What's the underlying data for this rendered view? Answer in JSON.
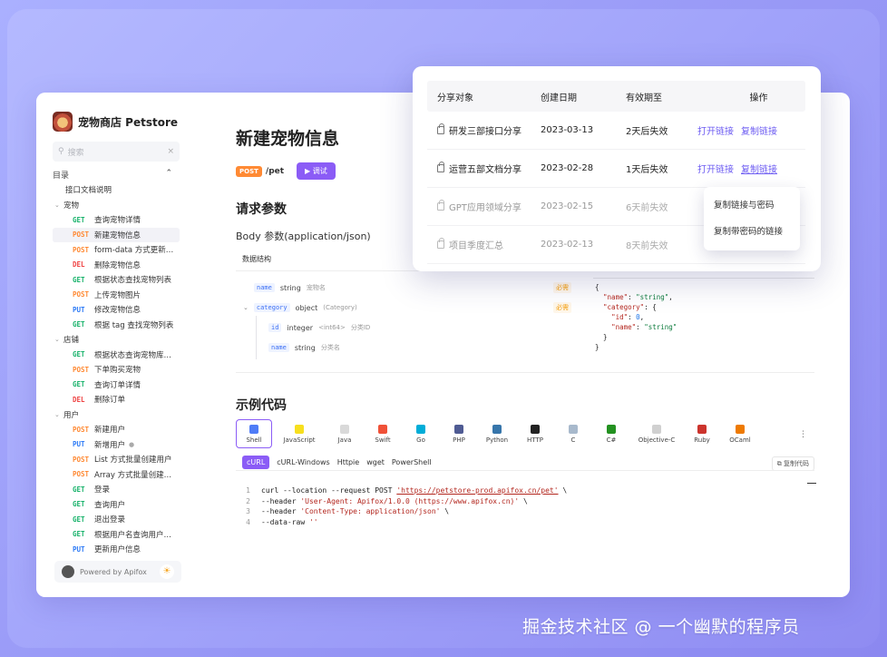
{
  "sidebar": {
    "brand": "宠物商店 Petstore",
    "search_placeholder": "搜索",
    "toc_label": "目录",
    "nav": [
      {
        "kind": "doc",
        "label": "接口文档说明"
      },
      {
        "kind": "group",
        "label": "宠物"
      },
      {
        "kind": "item",
        "method": "GET",
        "label": "查询宠物详情"
      },
      {
        "kind": "item",
        "method": "POST",
        "label": "新建宠物信息",
        "active": true
      },
      {
        "kind": "item",
        "method": "POST",
        "label": "form-data 方式更新宠..."
      },
      {
        "kind": "item",
        "method": "DEL",
        "label": "删除宠物信息"
      },
      {
        "kind": "item",
        "method": "GET",
        "label": "根据状态查找宠物列表"
      },
      {
        "kind": "item",
        "method": "POST",
        "label": "上传宠物图片"
      },
      {
        "kind": "item",
        "method": "PUT",
        "label": "修改宠物信息"
      },
      {
        "kind": "item",
        "method": "GET",
        "label": "根据 tag 查找宠物列表"
      },
      {
        "kind": "group",
        "label": "店铺"
      },
      {
        "kind": "item",
        "method": "GET",
        "label": "根据状态查询宠物库存数"
      },
      {
        "kind": "item",
        "method": "POST",
        "label": "下单购买宠物"
      },
      {
        "kind": "item",
        "method": "GET",
        "label": "查询订单详情"
      },
      {
        "kind": "item",
        "method": "DEL",
        "label": "删除订单"
      },
      {
        "kind": "group",
        "label": "用户"
      },
      {
        "kind": "item",
        "method": "POST",
        "label": "新建用户"
      },
      {
        "kind": "item",
        "method": "PUT",
        "label": "新增用户",
        "dot": true
      },
      {
        "kind": "item",
        "method": "POST",
        "label": "List 方式批量创建用户"
      },
      {
        "kind": "item",
        "method": "POST",
        "label": "Array 方式批量创建用户"
      },
      {
        "kind": "item",
        "method": "GET",
        "label": "登录"
      },
      {
        "kind": "item",
        "method": "GET",
        "label": "查询用户"
      },
      {
        "kind": "item",
        "method": "GET",
        "label": "退出登录"
      },
      {
        "kind": "item",
        "method": "GET",
        "label": "根据用户名查询用户信息"
      },
      {
        "kind": "item",
        "method": "PUT",
        "label": "更新用户信息"
      }
    ],
    "powered_by": "Powered by Apifox"
  },
  "content": {
    "title": "新建宠物信息",
    "method_badge": "POST",
    "path": "/pet",
    "try_button": "▶ 调试",
    "request_params": "请求参数",
    "body_params": "Body 参数(application/json)",
    "data_structure": "数据结构",
    "required_label": "必需",
    "fields": {
      "name": {
        "key": "name",
        "type": "string",
        "desc": "宠物名"
      },
      "category": {
        "key": "category",
        "type": "object",
        "type_ref": "(Category)"
      },
      "id": {
        "key": "id",
        "type": "integer",
        "type_fmt": "<int64>",
        "desc": "分类ID"
      },
      "cname": {
        "key": "name",
        "type": "string",
        "desc": "分类名"
      }
    },
    "json_example": [
      "{",
      "  \"name\": \"string\",",
      "  \"category\": {",
      "    \"id\": 0,",
      "    \"name\": \"string\"",
      "  }",
      "}"
    ],
    "sample_code": "示例代码",
    "languages": [
      "Shell",
      "JavaScript",
      "Java",
      "Swift",
      "Go",
      "PHP",
      "Python",
      "HTTP",
      "C",
      "C#",
      "Objective-C",
      "Ruby",
      "OCaml"
    ],
    "language_colors": [
      "#4f7cf7",
      "#f7df1e",
      "#d9d9d9",
      "#f05138",
      "#00add8",
      "#4f5b93",
      "#3776ab",
      "#222222",
      "#a8b9cc",
      "#239120",
      "#d0d0d0",
      "#cc342d",
      "#ee7a00"
    ],
    "more": "⋮",
    "subtabs": [
      "cURL",
      "cURL-Windows",
      "Httpie",
      "wget",
      "PowerShell"
    ],
    "copy_code": "复制代码",
    "code_lines": {
      "l1": {
        "n": "1",
        "pre": "curl --location --request POST ",
        "str": "'https://petstore-prod.apifox.cn/pet'",
        "post": " \\"
      },
      "l2": {
        "n": "2",
        "pre": "--header ",
        "str": "'User-Agent: Apifox/1.0.0 (https://www.apifox.cn)'",
        "post": " \\"
      },
      "l3": {
        "n": "3",
        "pre": "--header ",
        "str": "'Content-Type: application/json'",
        "post": " \\"
      },
      "l4": {
        "n": "4",
        "pre": "--data-raw ",
        "str": "''",
        "post": ""
      }
    }
  },
  "share": {
    "headers": {
      "target": "分享对象",
      "created": "创建日期",
      "valid": "有效期至",
      "action": "操作"
    },
    "rows": [
      {
        "target": "研发三部接口分享",
        "created": "2023-03-13",
        "valid": "2天后失效",
        "open": "打开链接",
        "copy": "复制链接"
      },
      {
        "target": "运营五部文档分享",
        "created": "2023-02-28",
        "valid": "1天后失效",
        "open": "打开链接",
        "copy": "复制链接"
      },
      {
        "target": "GPT应用领域分享",
        "created": "2023-02-15",
        "valid": "6天前失效"
      },
      {
        "target": "项目季度汇总",
        "created": "2023-02-13",
        "valid": "8天前失效"
      }
    ],
    "dropdown": [
      "复制链接与密码",
      "复制带密码的链接"
    ]
  },
  "watermark": "掘金技术社区 @ 一个幽默的程序员",
  "colors": {
    "accent": "#8b5cf6",
    "post": "#ff8a34",
    "get": "#17b26a",
    "put": "#2f7cf6",
    "del": "#ef4444"
  }
}
